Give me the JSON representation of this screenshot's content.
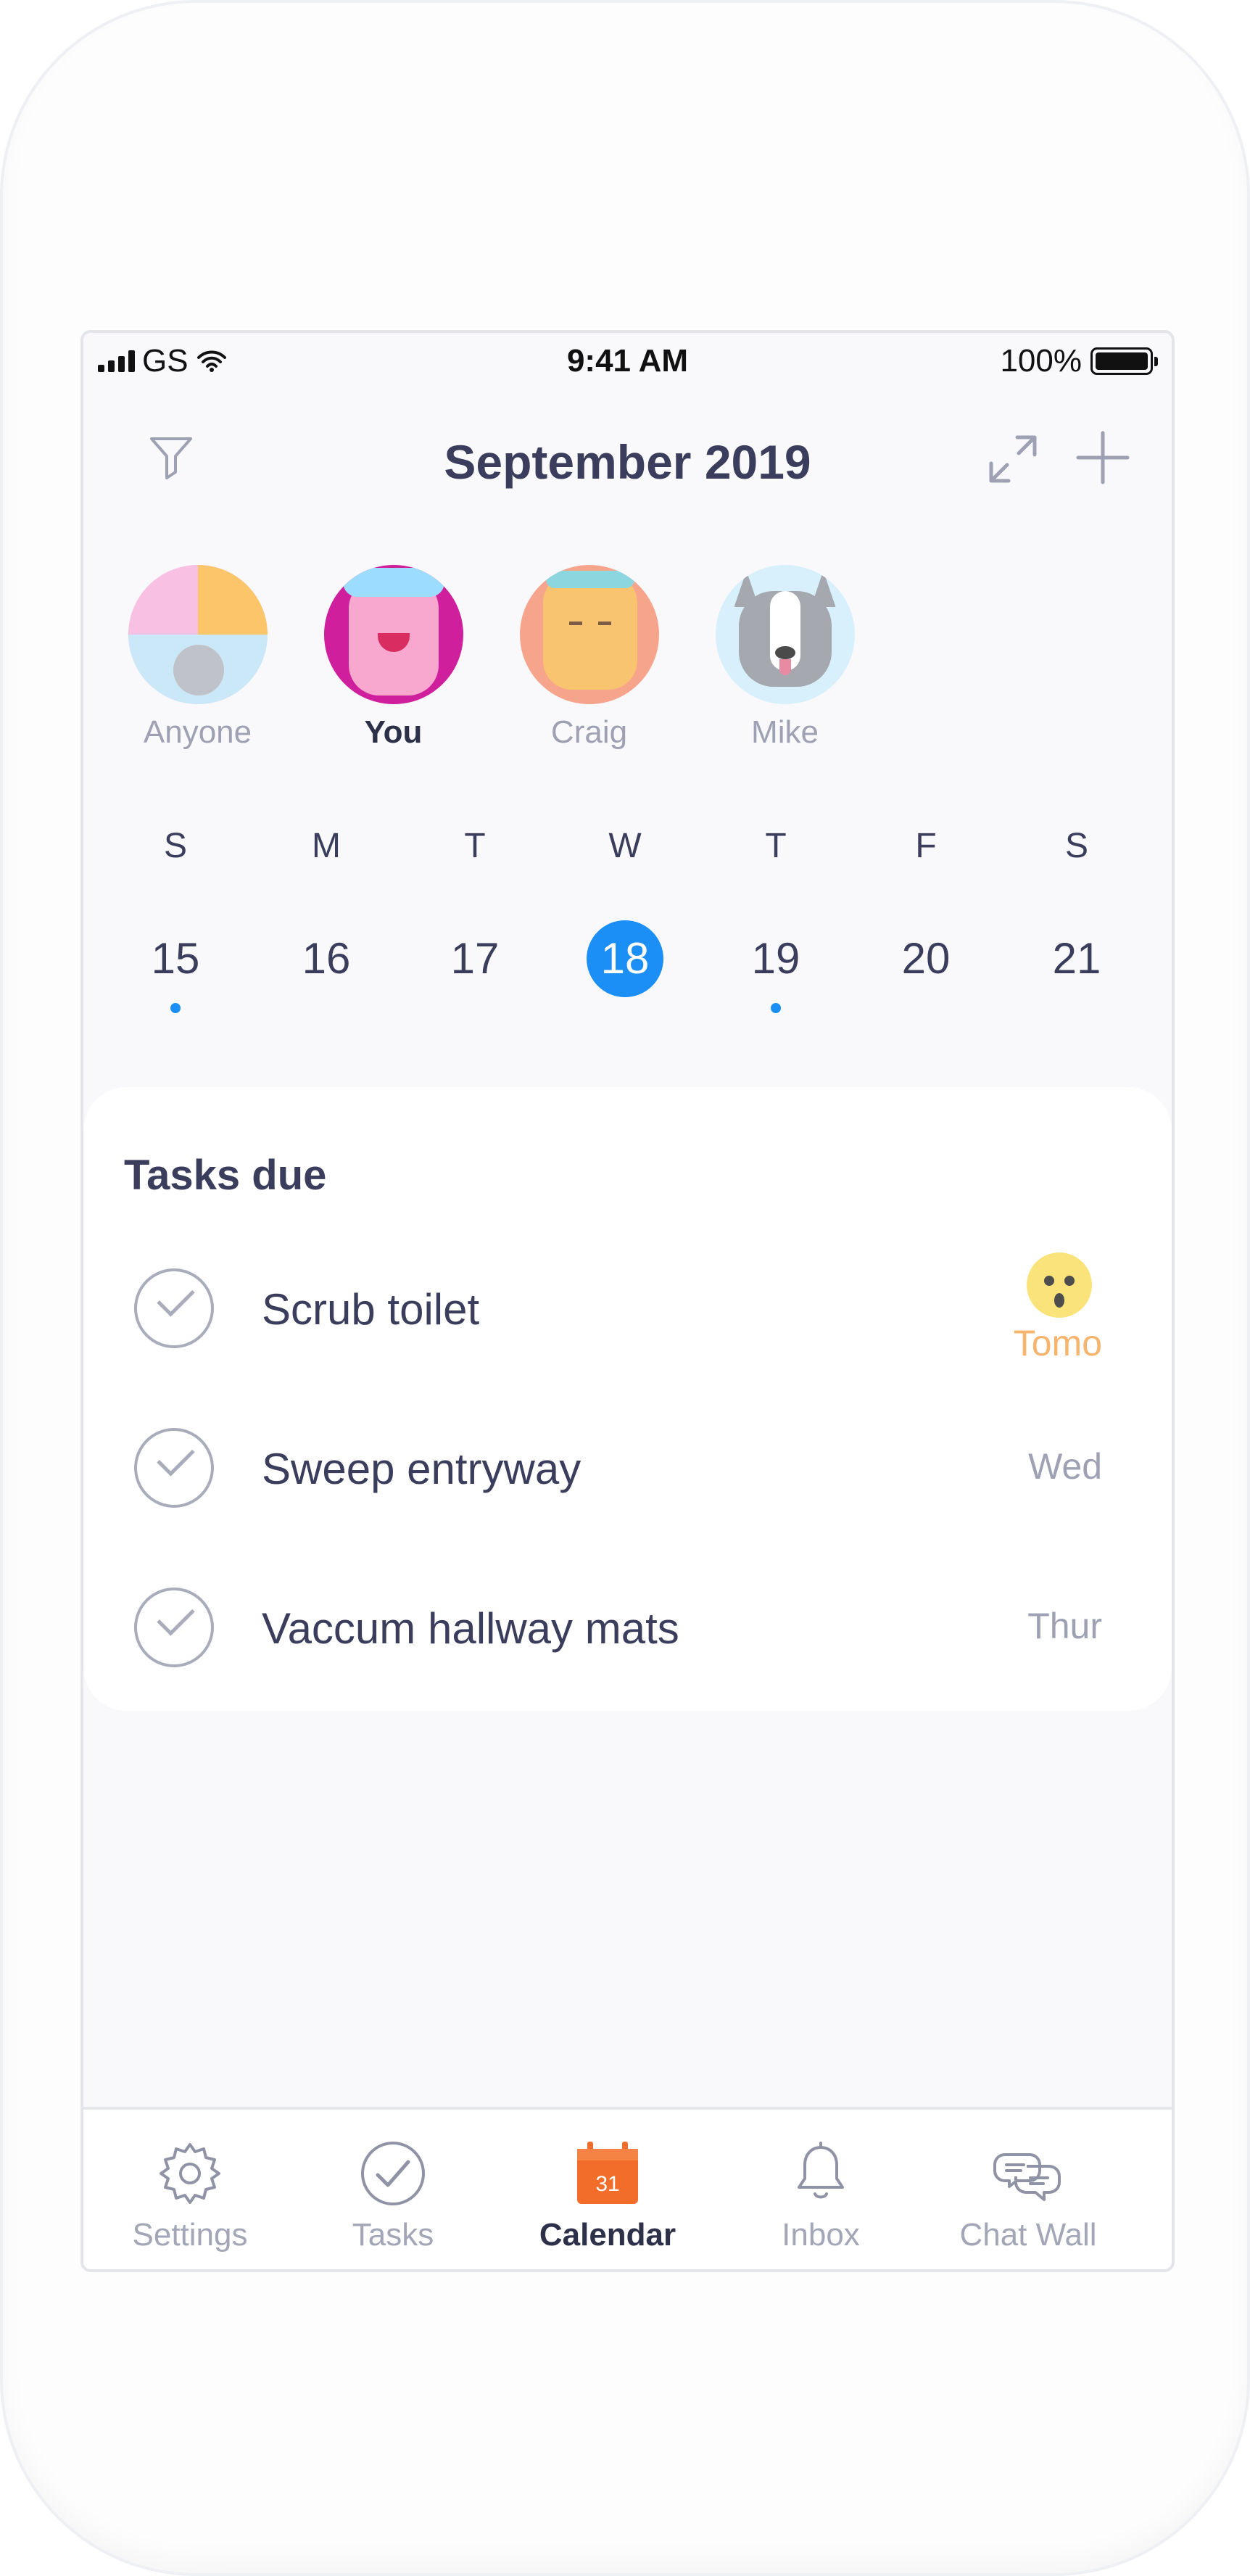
{
  "status_bar": {
    "carrier": "GS",
    "time": "9:41 AM",
    "battery": "100%"
  },
  "header": {
    "title": "September 2019",
    "left_icon": "filter-icon",
    "right_icons": [
      "expand-icon",
      "plus-icon"
    ]
  },
  "people": [
    {
      "name": "Anyone",
      "selected": false,
      "avatar_icon": "group-avatar-icon"
    },
    {
      "name": "You",
      "selected": true,
      "avatar_icon": "pink-avatar-icon"
    },
    {
      "name": "Craig",
      "selected": false,
      "avatar_icon": "orange-avatar-icon"
    },
    {
      "name": "Mike",
      "selected": false,
      "avatar_icon": "dog-avatar-icon"
    }
  ],
  "calendar": {
    "weekdays": [
      "S",
      "M",
      "T",
      "W",
      "T",
      "F",
      "S"
    ],
    "dates": [
      {
        "day": "15",
        "has_dot": true,
        "selected": false
      },
      {
        "day": "16",
        "has_dot": false,
        "selected": false
      },
      {
        "day": "17",
        "has_dot": false,
        "selected": false
      },
      {
        "day": "18",
        "has_dot": false,
        "selected": true
      },
      {
        "day": "19",
        "has_dot": true,
        "selected": false
      },
      {
        "day": "20",
        "has_dot": false,
        "selected": false
      },
      {
        "day": "21",
        "has_dot": false,
        "selected": false
      }
    ],
    "accent_color": "#1b8ff5"
  },
  "tasks": {
    "title": "Tasks due",
    "items": [
      {
        "label": "Scrub toilet",
        "meta": "Tomo",
        "meta_icon": "surprised-face-icon",
        "highlight": true
      },
      {
        "label": "Sweep entryway",
        "meta": "Wed",
        "highlight": false
      },
      {
        "label": "Vaccum hallway mats",
        "meta": "Thur",
        "highlight": false
      }
    ]
  },
  "bottom_nav": {
    "items": [
      {
        "label": "Settings",
        "icon": "gear-icon",
        "active": false
      },
      {
        "label": "Tasks",
        "icon": "check-circle-icon",
        "active": false
      },
      {
        "label": "Calendar",
        "icon": "calendar-icon",
        "active": true,
        "calendar_day": "31"
      },
      {
        "label": "Inbox",
        "icon": "bell-icon",
        "active": false
      },
      {
        "label": "Chat Wall",
        "icon": "chat-icon",
        "active": false
      }
    ],
    "active_color": "#f26c2a"
  }
}
